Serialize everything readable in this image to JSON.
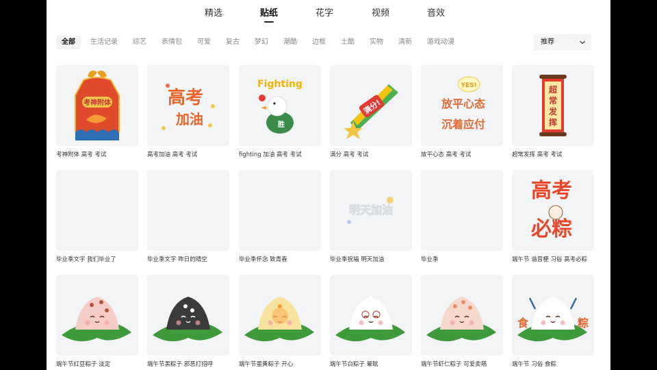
{
  "tabs": [
    {
      "label": "精选",
      "active": false
    },
    {
      "label": "贴纸",
      "active": true
    },
    {
      "label": "花字",
      "active": false
    },
    {
      "label": "视频",
      "active": false
    },
    {
      "label": "音效",
      "active": false
    }
  ],
  "filters": [
    {
      "label": "全部",
      "active": true
    },
    {
      "label": "生活记录",
      "active": false
    },
    {
      "label": "综艺",
      "active": false
    },
    {
      "label": "表情包",
      "active": false
    },
    {
      "label": "可爱",
      "active": false
    },
    {
      "label": "复古",
      "active": false
    },
    {
      "label": "梦幻",
      "active": false
    },
    {
      "label": "潮酷",
      "active": false
    },
    {
      "label": "边框",
      "active": false
    },
    {
      "label": "土酷",
      "active": false
    },
    {
      "label": "实物",
      "active": false
    },
    {
      "label": "清新",
      "active": false
    },
    {
      "label": "游戏动漫",
      "active": false
    }
  ],
  "sort": {
    "selected": "推荐",
    "icon": "chevron-down-icon"
  },
  "stickers": [
    {
      "caption": "考神附体 高考 考试",
      "art": "amulet",
      "art_text": [
        "考神附体"
      ]
    },
    {
      "caption": "高考加油 高考 考试",
      "art": "text-gaokao",
      "art_text": [
        "高考",
        "加油"
      ]
    },
    {
      "caption": "fighting 加油 高考 考试",
      "art": "duck-fighting",
      "art_text": [
        "Fighting",
        "胜"
      ]
    },
    {
      "caption": "满分 高考 考试",
      "art": "shooting-star",
      "art_text": [
        "满分!"
      ]
    },
    {
      "caption": "放平心态 高考 考试",
      "art": "text-calm",
      "art_text": [
        "YES!",
        "放平心态",
        "沉着应付"
      ]
    },
    {
      "caption": "超常发挥 高考 考试",
      "art": "scroll",
      "art_text": [
        "超",
        "常",
        "发",
        "挥"
      ]
    },
    {
      "caption": "毕业季文字 我们毕业了",
      "art": "blank",
      "art_text": []
    },
    {
      "caption": "毕业季文字 昨日的晴空",
      "art": "blank",
      "art_text": []
    },
    {
      "caption": "毕业季怀念 致青春",
      "art": "blank",
      "art_text": []
    },
    {
      "caption": "毕业季祝福 明天加油",
      "art": "text-tomorrow",
      "art_text": [
        "明天加油"
      ]
    },
    {
      "caption": "毕业季",
      "art": "blank",
      "art_text": []
    },
    {
      "caption": "端午节 谐音梗 习俗 高考必粽",
      "art": "text-bizong",
      "art_text": [
        "高考",
        "必粽"
      ]
    },
    {
      "caption": "端午节红豆粽子 淡定",
      "art": "zongzi-pink",
      "art_text": []
    },
    {
      "caption": "端午节黑粽子 邪恶打招呼",
      "art": "zongzi-black",
      "art_text": []
    },
    {
      "caption": "端午节蛋黄粽子 开心",
      "art": "zongzi-yellow",
      "art_text": []
    },
    {
      "caption": "端午节白粽子 晕眩",
      "art": "zongzi-white",
      "art_text": []
    },
    {
      "caption": "端午节虾仁粽子 可爱卖萌",
      "art": "zongzi-shrimp",
      "art_text": []
    },
    {
      "caption": "端午节 习俗 食粽",
      "art": "zongzi-eat",
      "art_text": [
        "食",
        "粽"
      ]
    }
  ],
  "colors": {
    "panel_bg": "#ffffff",
    "thumb_bg": "#f3f4f5",
    "active_text": "#111111",
    "muted_text": "#888888",
    "sticker_orange": "#e8652c",
    "leaf_green": "#3f9a3c"
  }
}
